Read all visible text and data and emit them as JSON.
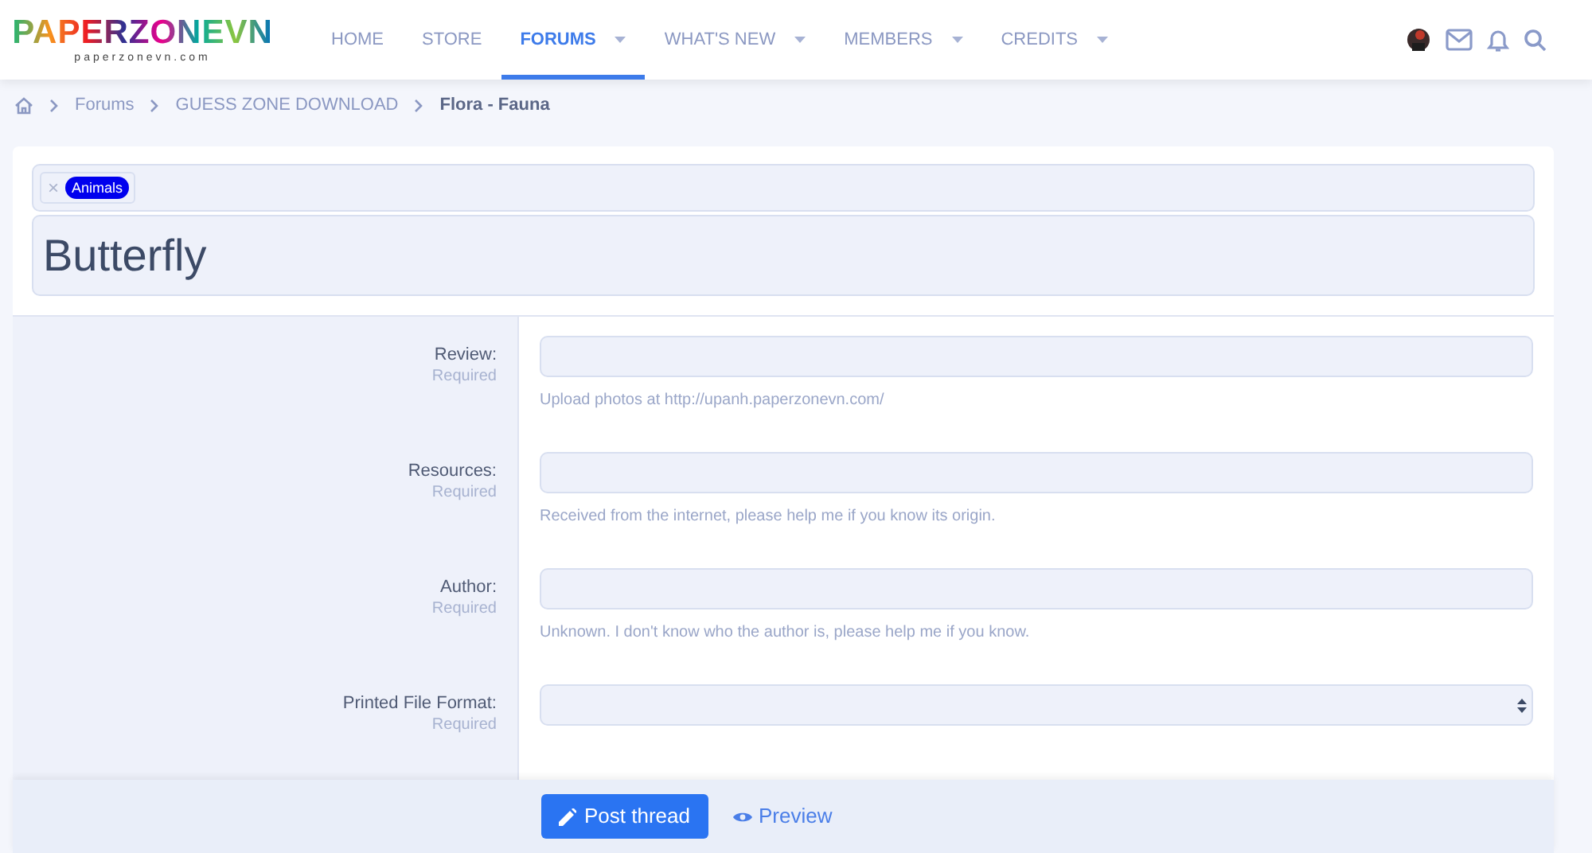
{
  "logo": {
    "name": "PAPERZONEVN",
    "domain": "paperzonevn.com"
  },
  "nav": [
    {
      "label": "HOME",
      "selected": false,
      "has_menu": false
    },
    {
      "label": "STORE",
      "selected": false,
      "has_menu": false
    },
    {
      "label": "FORUMS",
      "selected": true,
      "has_menu": true
    },
    {
      "label": "WHAT'S NEW",
      "selected": false,
      "has_menu": true
    },
    {
      "label": "MEMBERS",
      "selected": false,
      "has_menu": true
    },
    {
      "label": "CREDITS",
      "selected": false,
      "has_menu": true
    }
  ],
  "breadcrumb": [
    "Forums",
    "GUESS ZONE DOWNLOAD",
    "Flora - Fauna"
  ],
  "tags": [
    {
      "remove": "×",
      "label": "Animals"
    }
  ],
  "thread_title": "Butterfly",
  "fields": [
    {
      "label": "Review:",
      "required": "Required",
      "kind": "text",
      "hint": "Upload photos at http://upanh.paperzonevn.com/"
    },
    {
      "label": "Resources:",
      "required": "Required",
      "kind": "text",
      "hint": "Received from the internet, please help me if you know its origin."
    },
    {
      "label": "Author:",
      "required": "Required",
      "kind": "text",
      "hint": "Unknown. I don't know who the author is, please help me if you know."
    },
    {
      "label": "Printed File Format:",
      "required": "Required",
      "kind": "select"
    }
  ],
  "buttons": {
    "post": "Post thread",
    "preview": "Preview"
  }
}
